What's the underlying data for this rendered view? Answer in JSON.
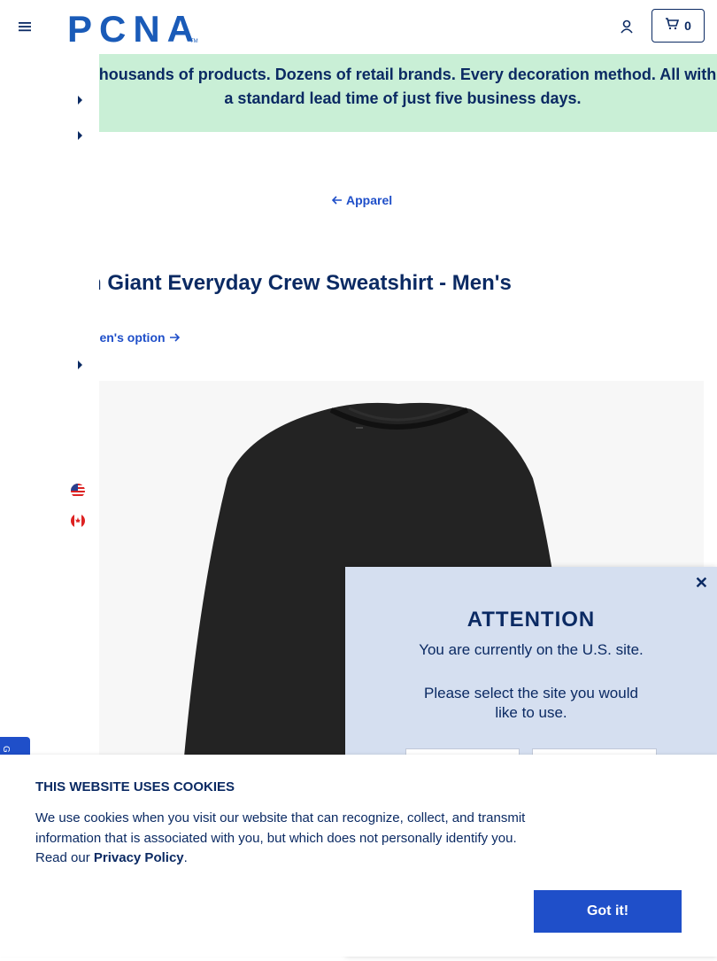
{
  "header": {
    "logo_text": "PCNA",
    "cart_count": "0"
  },
  "promo": {
    "text": "Thousands of products. Dozens of retail brands. Every decoration method. All with a standard lead time of just five business days."
  },
  "breadcrumb": {
    "back_label": "Apparel"
  },
  "product": {
    "title": "n Giant Everyday Crew Sweatshirt - Men's",
    "alt_option_label": "men's option"
  },
  "modal": {
    "title": "ATTENTION",
    "message": "You are currently on the U.S. site.",
    "prompt": "Please select the site you would like to use."
  },
  "feedback_tab": {
    "label": "G"
  },
  "cookie": {
    "title": "THIS WEBSITE USES COOKIES",
    "body": "We use cookies when you visit our website that can recognize, collect, and transmit information that is associated with you, but which does not personally identify you. Read our",
    "policy_link": "Privacy Policy",
    "period": ".",
    "accept_label": "Got it!"
  }
}
